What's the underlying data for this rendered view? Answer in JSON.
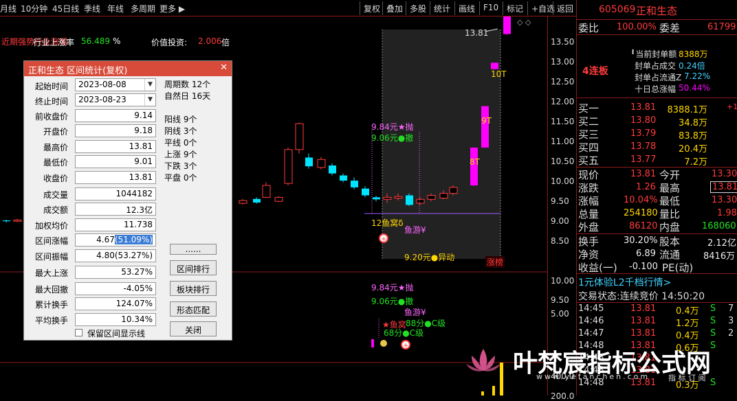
{
  "toolbar": {
    "left_items": [
      "月线",
      "10分钟",
      "45日线",
      "季线",
      "年线",
      "多周期",
      "更多"
    ],
    "right_buttons": [
      "复权",
      "叠加",
      "多股",
      "统计",
      "画线",
      "F10",
      "标记",
      "+自选",
      "返回"
    ]
  },
  "chart_header": {
    "indicator_text": "近期强势行业涨幅",
    "industry_label": "行业上涨率",
    "industry_value": "56.489",
    "industry_unit": "%",
    "value_label": "价值投资:",
    "value_value": "2.006",
    "value_unit": "倍"
  },
  "price_axis": [
    "13.50",
    "13.00",
    "12.50",
    "12.00",
    "11.50",
    "11.00",
    "10.50",
    "10.00",
    "9.50",
    "9.00",
    "8.50"
  ],
  "lower_axis": [
    "10.00",
    "9.50",
    "5.00",
    "400.0",
    "200.0"
  ],
  "chart_annotations": {
    "high_label": "13.81",
    "limit_up_10": "10T",
    "limit_up_9": "9T",
    "limit_up_8": "8T",
    "sell_signal": "9.84元★抛",
    "cancel_signal": "9.06元●撤",
    "fish_nest": "12鱼窝δ",
    "fish_swim": "鱼游¥",
    "abnormal": "9.20元●异动",
    "zhangbang": "涨榜",
    "lower_sell": "9.84元★抛",
    "lower_cancel": "9.06元●撤",
    "lower_fish_swim": "鱼游¥",
    "lower_fish_nest": "★鱼窝",
    "score_1": "88分●C级",
    "score_2": "68分●C级"
  },
  "candles": [
    {
      "o": 8.62,
      "c": 8.6,
      "h": 8.64,
      "l": 8.57
    },
    {
      "o": 8.6,
      "c": 8.63,
      "h": 8.66,
      "l": 8.58
    },
    {
      "o": 9.05,
      "c": 9.12,
      "h": 9.16,
      "l": 9.02
    },
    {
      "o": 9.16,
      "c": 9.07,
      "h": 9.2,
      "l": 9.04
    },
    {
      "o": 9.1,
      "c": 9.2,
      "h": 9.23,
      "l": 9.08
    },
    {
      "o": 9.2,
      "c": 9.5,
      "h": 9.58,
      "l": 9.18
    },
    {
      "o": 9.55,
      "c": 10.4,
      "h": 10.45,
      "l": 9.5
    },
    {
      "o": 10.4,
      "c": 11.05,
      "h": 11.08,
      "l": 10.3
    },
    {
      "o": 10.2,
      "c": 9.98,
      "h": 10.3,
      "l": 9.92
    },
    {
      "o": 9.95,
      "c": 10.15,
      "h": 10.22,
      "l": 9.9
    },
    {
      "o": 10.0,
      "c": 9.8,
      "h": 10.05,
      "l": 9.75
    },
    {
      "o": 9.75,
      "c": 9.62,
      "h": 9.8,
      "l": 9.58
    },
    {
      "o": 9.62,
      "c": 9.45,
      "h": 9.7,
      "l": 9.4
    },
    {
      "o": 9.42,
      "c": 9.25,
      "h": 9.48,
      "l": 9.2
    },
    {
      "o": 9.2,
      "c": 9.15,
      "h": 9.24,
      "l": 9.1
    },
    {
      "o": 9.15,
      "c": 9.2,
      "h": 9.3,
      "l": 9.06
    },
    {
      "o": 9.18,
      "c": 9.22,
      "h": 9.3,
      "l": 9.12
    },
    {
      "o": 9.25,
      "c": 9.01,
      "h": 9.3,
      "l": 8.98
    },
    {
      "o": 9.05,
      "c": 9.15,
      "h": 9.2,
      "l": 9.01
    },
    {
      "o": 9.15,
      "c": 9.25,
      "h": 9.3,
      "l": 9.1
    },
    {
      "o": 9.18,
      "c": 9.3,
      "h": 9.38,
      "l": 9.15
    },
    {
      "o": 9.3,
      "c": 9.45,
      "h": 9.5,
      "l": 9.25
    },
    {
      "o": 9.5,
      "c": 10.45,
      "h": 10.45,
      "l": 9.48
    },
    {
      "o": 10.45,
      "c": 11.49,
      "h": 11.49,
      "l": 10.45
    },
    {
      "o": 12.42,
      "c": 12.58,
      "h": 12.58,
      "l": 12.4
    },
    {
      "o": 13.3,
      "c": 13.81,
      "h": 13.81,
      "l": 13.28
    }
  ],
  "dialog": {
    "title": "正和生态  区间统计(复权)",
    "start_label": "起始时间",
    "start_value": "2023-08-08",
    "end_label": "终止时间",
    "end_value": "2023-08-23",
    "rows": [
      {
        "label": "前收盘价",
        "value": "9.14"
      },
      {
        "label": "开盘价",
        "value": "9.18"
      },
      {
        "label": "最高价",
        "value": "13.81"
      },
      {
        "label": "最低价",
        "value": "9.01"
      },
      {
        "label": "收盘价",
        "value": "13.81"
      },
      {
        "label": "成交量",
        "value": "1044182"
      },
      {
        "label": "成交额",
        "value": "12.3亿"
      },
      {
        "label": "加权均价",
        "value": "11.738"
      }
    ],
    "range_change_label": "区间涨幅",
    "range_change_value": "4.67",
    "range_change_pct": "(51.09%)",
    "rows2": [
      {
        "label": "区间振幅",
        "value": "4.80(53.27%)"
      },
      {
        "label": "最大上涨",
        "value": "53.27%"
      },
      {
        "label": "最大回撤",
        "value": "-4.05%"
      },
      {
        "label": "累计换手",
        "value": "124.07%"
      },
      {
        "label": "平均换手",
        "value": "10.34%"
      }
    ],
    "checkbox_label": "保留区间显示线",
    "stats": [
      "周期数 12个",
      "自然日 16天",
      "阳线 9个",
      "阴线 3个",
      "平线 0个",
      "上涨 9个",
      "下跌 3个",
      "平盘 0个"
    ],
    "buttons": [
      "......",
      "区间排行",
      "板块排行",
      "形态匹配",
      "关闭"
    ]
  },
  "quote": {
    "code": "605069",
    "name": "正和生态",
    "weibi_label": "委比",
    "weibi_value": "100.00%",
    "weicha_label": "委差",
    "weicha_value": "61799",
    "lianban": "4连板",
    "seal_rows": [
      {
        "label": "当前封单额",
        "value": "8388万"
      },
      {
        "label": "封单占成交",
        "value": "0.24倍"
      },
      {
        "label": "封单占流通Z",
        "value": "7.22%"
      },
      {
        "label": "十日总涨幅",
        "value": "50.44%"
      }
    ],
    "bids": [
      {
        "label": "买一",
        "price": "13.81",
        "vol": "8388.1万",
        "chg": "+1"
      },
      {
        "label": "买二",
        "price": "13.80",
        "vol": "34.8万",
        "chg": ""
      },
      {
        "label": "买三",
        "price": "13.79",
        "vol": "83.8万",
        "chg": ""
      },
      {
        "label": "买四",
        "price": "13.78",
        "vol": "20.4万",
        "chg": ""
      },
      {
        "label": "买五",
        "price": "13.77",
        "vol": "7.2万",
        "chg": ""
      }
    ],
    "stats": [
      {
        "l1": "现价",
        "v1": "13.81",
        "l2": "今开",
        "v2": "13.30"
      },
      {
        "l1": "涨跌",
        "v1": "1.26",
        "l2": "最高",
        "v2": "13.81"
      },
      {
        "l1": "涨幅",
        "v1": "10.04%",
        "l2": "最低",
        "v2": "13.30"
      },
      {
        "l1": "总量",
        "v1": "254180",
        "l2": "量比",
        "v2": "1.98"
      },
      {
        "l1": "外盘",
        "v1": "86120",
        "l2": "内盘",
        "v2": "168060"
      }
    ],
    "stats2": [
      {
        "l1": "换手",
        "v1": "30.20%",
        "l2": "股本",
        "v2": "2.12亿"
      },
      {
        "l1": "净资",
        "v1": "6.89",
        "l2": "流通",
        "v2": "8416万"
      },
      {
        "l1": "收益(一)",
        "v1": "-0.100",
        "l2": "PE(动)",
        "v2": ""
      }
    ],
    "promo": "1元体验L2千档行情>",
    "trade_status_label": "交易状态:",
    "trade_status_value": "连续竞价",
    "trade_time": "14:50:20",
    "ticks": [
      {
        "time": "14:45",
        "price": "13.81",
        "vol": "0.4万",
        "side": "S",
        "n": "7"
      },
      {
        "time": "14:46",
        "price": "13.81",
        "vol": "1.2万",
        "side": "S",
        "n": "3"
      },
      {
        "time": "14:47",
        "price": "13.81",
        "vol": "0.4万",
        "side": "S",
        "n": "2"
      },
      {
        "time": "14:48",
        "price": "13.81",
        "vol": "0.6万",
        "side": "S",
        "n": ""
      },
      {
        "time": "14:48",
        "price": "13.81",
        "vol": "",
        "side": "",
        "n": ""
      },
      {
        "time": "14:48",
        "price": "13.81",
        "vol": "",
        "side": "",
        "n": ""
      },
      {
        "time": "14:48",
        "price": "13.81",
        "vol": "0.3万",
        "side": "S",
        "n": ""
      }
    ]
  },
  "watermark": {
    "text": "叶梵宸指标公式网",
    "url": "www.yefanchen.com",
    "sub": "指 标 订 阅"
  },
  "colors": {
    "up": "#ff3b3b",
    "down": "#00e5ff",
    "limit_up": "#ff00ff",
    "border": "#8b1a1a",
    "signal": "#ff66ff",
    "green_signal": "#22e022"
  }
}
